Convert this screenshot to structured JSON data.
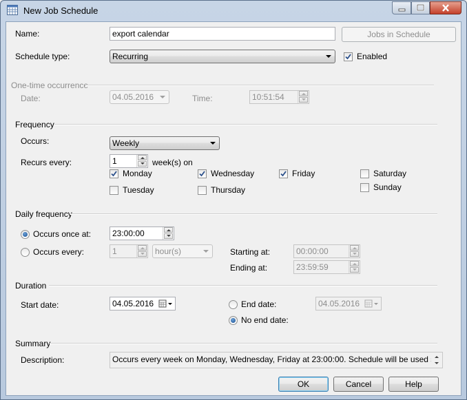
{
  "window": {
    "title": "New Job Schedule"
  },
  "general": {
    "name_label": "Name:",
    "name_value": "export calendar",
    "jobs_button": "Jobs in Schedule",
    "schedule_type_label": "Schedule type:",
    "schedule_type_value": "Recurring",
    "enabled_label": "Enabled",
    "enabled_checked": true
  },
  "one_time": {
    "header": "One-time occurrence",
    "date_label": "Date:",
    "date_value": "04.05.2016",
    "time_label": "Time:",
    "time_value": "10:51:54"
  },
  "frequency": {
    "header": "Frequency",
    "occurs_label": "Occurs:",
    "occurs_value": "Weekly",
    "recurs_label": "Recurs every:",
    "recurs_value": "1",
    "recurs_unit": "week(s) on",
    "days": [
      {
        "label": "Monday",
        "checked": true
      },
      {
        "label": "Wednesday",
        "checked": true
      },
      {
        "label": "Friday",
        "checked": true
      },
      {
        "label": "Saturday",
        "checked": false
      },
      {
        "label": "Tuesday",
        "checked": false
      },
      {
        "label": "Thursday",
        "checked": false
      },
      {
        "label": "Sunday",
        "checked": false
      }
    ]
  },
  "daily": {
    "header": "Daily frequency",
    "once_label": "Occurs once at:",
    "once_value": "23:00:00",
    "every_label": "Occurs every:",
    "every_value": "1",
    "every_unit": "hour(s)",
    "starting_label": "Starting at:",
    "starting_value": "00:00:00",
    "ending_label": "Ending at:",
    "ending_value": "23:59:59"
  },
  "duration": {
    "header": "Duration",
    "start_label": "Start date:",
    "start_value": "04.05.2016",
    "end_label": "End date:",
    "end_value": "04.05.2016",
    "no_end_label": "No end date:"
  },
  "summary": {
    "header": "Summary",
    "description_label": "Description:",
    "description_value": "Occurs every week on Monday, Wednesday, Friday at 23:00:00. Schedule will be used starting"
  },
  "buttons": {
    "ok": "OK",
    "cancel": "Cancel",
    "help": "Help"
  },
  "colors": {
    "title_bar": "#b8c9de",
    "close_button": "#c4402a",
    "default_button": "#3c7fb1"
  }
}
